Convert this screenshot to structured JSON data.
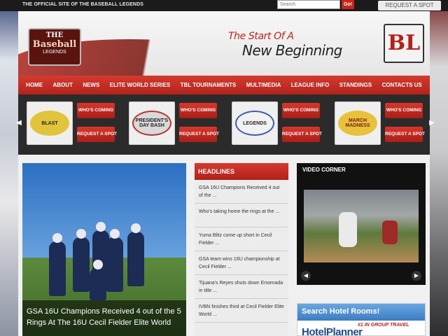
{
  "topbar": {
    "official_text": "THE OFFICIAL SITE OF THE BASEBALL LEGENDS",
    "search_placeholder": "Search",
    "go_label": "Go!",
    "request_spot_label": "REQUEST A SPOT"
  },
  "header": {
    "logo_left": {
      "line1": "THE",
      "line2": "Baseball",
      "line3": "LEGENDS"
    },
    "tagline_line1": "The Start Of A",
    "tagline_line2": "New Beginning",
    "logo_right": "BL"
  },
  "nav": {
    "items": [
      {
        "label": "HOME"
      },
      {
        "label": "ABOUT"
      },
      {
        "label": "NEWS"
      },
      {
        "label": "ELITE WORLD SERIES"
      },
      {
        "label": "TBL TOURNAMENTS"
      },
      {
        "label": "MULTIMEDIA"
      },
      {
        "label": "LEAGUE INFO"
      },
      {
        "label": "STANDINGS"
      },
      {
        "label": "CONTACTS US"
      }
    ]
  },
  "tournaments": [
    {
      "name": "BLAST",
      "who_label": "WHO'S COMING",
      "request_label": "REQUEST A SPOT",
      "color": "#e2c43a"
    },
    {
      "name": "PRESIDENT'S DAY BASH",
      "who_label": "WHO'S COMING",
      "request_label": "REQUEST A SPOT",
      "color": "#b8342a"
    },
    {
      "name": "LEGENDS",
      "who_label": "WHO'S COMING",
      "request_label": "REQUEST A SPOT",
      "color": "#3a5ea8"
    },
    {
      "name": "MARCH MADNESS",
      "who_label": "WHO'S COMING",
      "request_label": "REQUEST A SPOT",
      "color": "#e8c23a"
    }
  ],
  "feature": {
    "caption": "GSA 16U Champions Received 4 out of the 5 Rings At The 16U Cecil Fielder Elite World"
  },
  "headlines": {
    "title": "HEADLINES",
    "items": [
      "GSA 16U Champions Received 4 out of the ...",
      "Who's taking home the rings at the ...",
      "Yuma Blitz come up short in Cecil Fielder ...",
      "GSA team wins 16U championship at Cecil Fielder ...",
      "Tijuana's Reyes shuts down Ensenada in title ...",
      "IVBN finishes third at Cecil Fielder Elite World ..."
    ]
  },
  "video": {
    "title": "VIDEO CORNER"
  },
  "hotel": {
    "title": "Search Hotel Rooms!",
    "subtitle": "#1 IN GROUP TRAVEL",
    "brand": "HotelPlanner"
  }
}
